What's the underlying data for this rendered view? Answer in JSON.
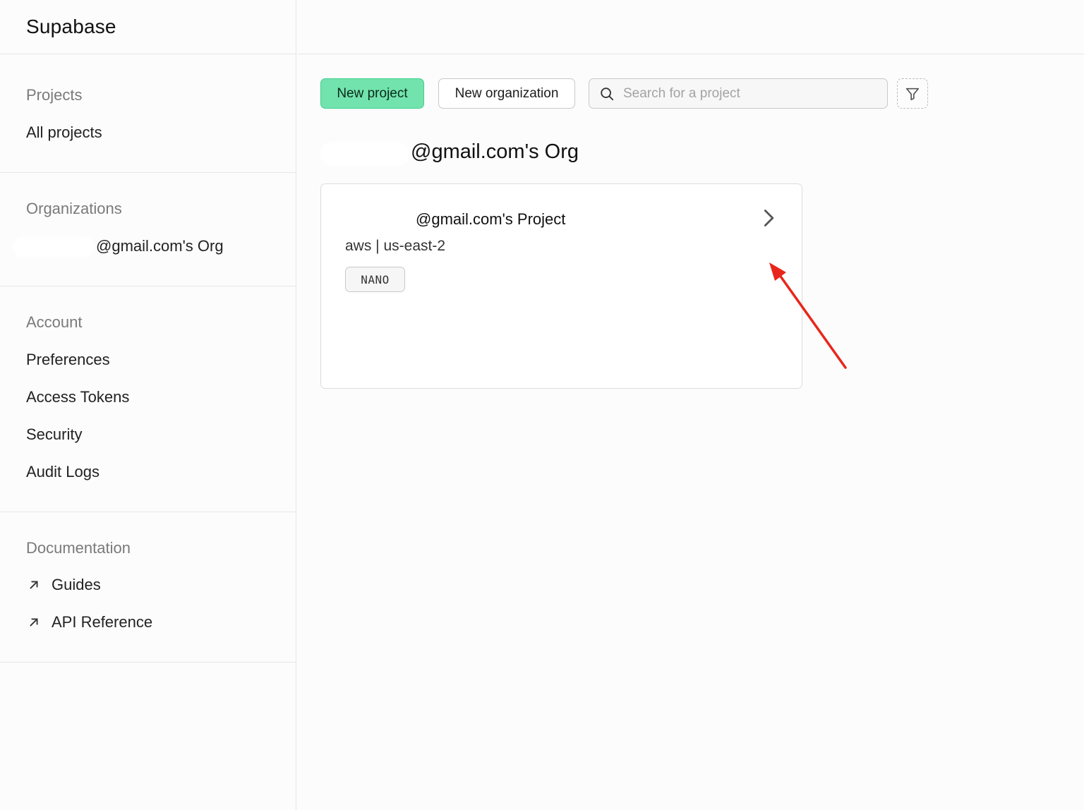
{
  "app": {
    "brand": "Supabase"
  },
  "sidebar": {
    "projects": {
      "heading": "Projects",
      "items": [
        "All projects"
      ]
    },
    "organizations": {
      "heading": "Organizations",
      "items": [
        "@gmail.com's Org"
      ]
    },
    "account": {
      "heading": "Account",
      "items": [
        "Preferences",
        "Access Tokens",
        "Security",
        "Audit Logs"
      ]
    },
    "documentation": {
      "heading": "Documentation",
      "items": [
        "Guides",
        "API Reference"
      ]
    }
  },
  "toolbar": {
    "new_project_label": "New project",
    "new_org_label": "New organization",
    "search_placeholder": "Search for a project",
    "filter_icon": "filter-icon"
  },
  "org": {
    "title": "@gmail.com's Org"
  },
  "project_card": {
    "title": "@gmail.com's Project",
    "region": "aws | us-east-2",
    "badge": "NANO",
    "chevron_icon": "chevron-right-icon"
  },
  "colors": {
    "primary_button": "#72e3ad",
    "primary_border": "#3ecf8e",
    "annotation_arrow": "#e8261b"
  }
}
